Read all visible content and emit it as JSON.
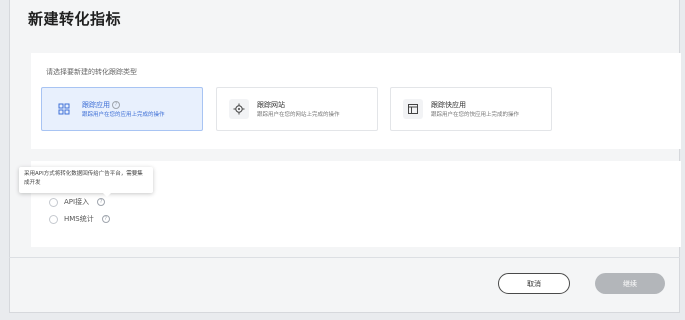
{
  "page_title": "新建转化指标",
  "tracking_section": {
    "prompt": "请选择要新建的转化跟踪类型",
    "types": [
      {
        "title": "跟踪应用",
        "description": "跟踪用户在您的应用上完成的操作",
        "icon": "app-grid-icon",
        "selected": true,
        "has_help": true
      },
      {
        "title": "跟踪网站",
        "description": "跟踪用户在您的网站上完成的操作",
        "icon": "crosshair-target-icon",
        "selected": false,
        "has_help": false
      },
      {
        "title": "跟踪快应用",
        "description": "跟踪用户在您的快应用上完成的操作",
        "icon": "quick-app-window-icon",
        "selected": false,
        "has_help": false
      }
    ]
  },
  "access_section": {
    "tooltip": "采用API方式将转化数据回传给广告平台，需要集成开发",
    "options": [
      {
        "label": "API接入",
        "selected": false
      },
      {
        "label": "HMS统计",
        "selected": false
      }
    ]
  },
  "footer": {
    "cancel_label": "取消",
    "next_label": "继续"
  },
  "colors": {
    "accent": "#3e6fd6",
    "selected_bg": "#e8f0fd",
    "disabled_button": "#b3b6ba"
  }
}
